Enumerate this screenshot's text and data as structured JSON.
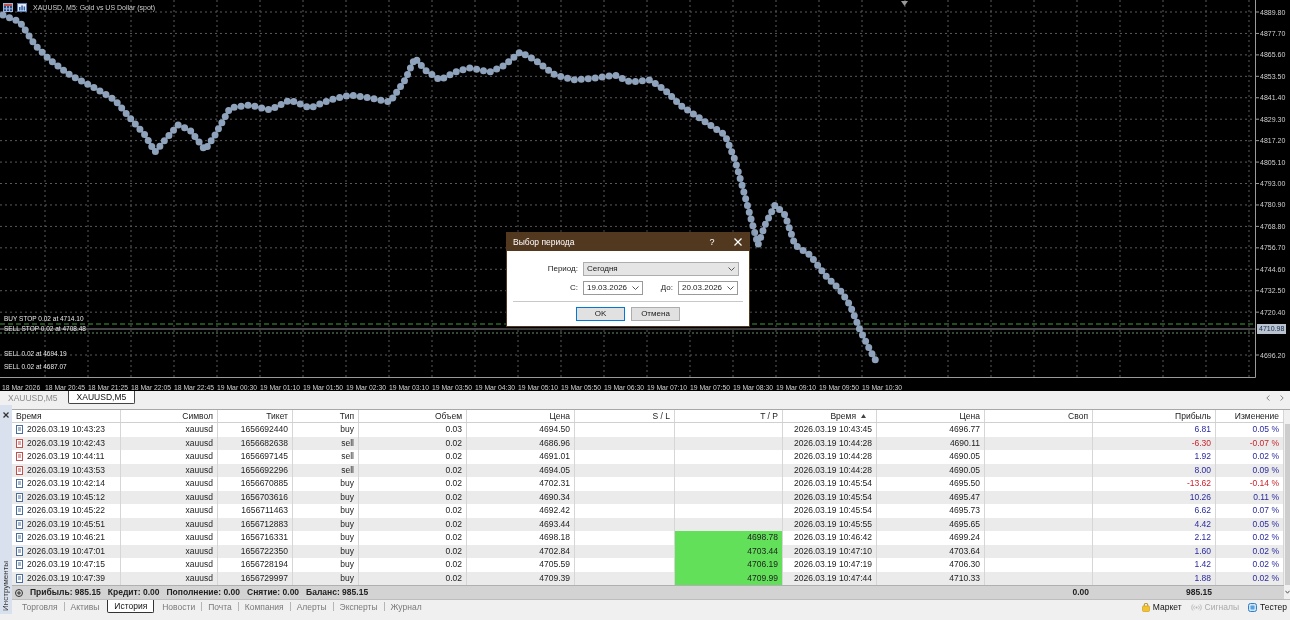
{
  "chart": {
    "title": "XAUUSD, M5: Gold vs US Dollar (spot)",
    "price_labels": [
      "4889.80",
      "4877.70",
      "4865.60",
      "4853.50",
      "4841.40",
      "4829.30",
      "4817.20",
      "4805.10",
      "4793.00",
      "4780.90",
      "4768.80",
      "4756.70",
      "4744.60",
      "4732.50",
      "4720.40",
      "4696.20"
    ],
    "current_price": "4710.98",
    "time_labels": [
      "18 Mar 2026",
      "18 Mar 20:45",
      "18 Mar 21:25",
      "18 Mar 22:05",
      "18 Mar 22:45",
      "19 Mar 00:30",
      "19 Mar 01:10",
      "19 Mar 01:50",
      "19 Mar 02:30",
      "19 Mar 03:10",
      "19 Mar 03:50",
      "19 Mar 04:30",
      "19 Mar 05:10",
      "19 Mar 05:50",
      "19 Mar 06:30",
      "19 Mar 07:10",
      "19 Mar 07:50",
      "19 Mar 08:30",
      "19 Mar 09:10",
      "19 Mar 09:50",
      "19 Mar 10:30"
    ],
    "order_lines": [
      {
        "label": "BUY STOP 0.02 at 4714.10",
        "kind": "buy_stop"
      },
      {
        "label": "SELL STOP 0.02 at 4708.48",
        "kind": "sell_stop"
      },
      {
        "label": "SELL 0.02 at 4694.19",
        "kind": "sell"
      },
      {
        "label": "SELL 0.02 at 4687.07",
        "kind": "sell"
      }
    ]
  },
  "dialog": {
    "title": "Выбор периода",
    "help": "?",
    "fields": [
      {
        "label": "Период:",
        "value": "Сегодня",
        "kind": "select"
      },
      {
        "label": "С:",
        "value": "19.03.2026",
        "kind": "date"
      },
      {
        "label": "До:",
        "value": "20.03.2026",
        "kind": "date"
      }
    ],
    "buttons": [
      {
        "label": "OK",
        "default": true
      },
      {
        "label": "Отмена",
        "default": false
      }
    ]
  },
  "chart_tabs": [
    {
      "label": "XAUUSD,M5",
      "selected": false
    },
    {
      "label": "XAUUSD,M5",
      "selected": true
    }
  ],
  "toolbox": {
    "title": "Инструменты",
    "table": {
      "columns": [
        {
          "label": "Время",
          "sorted": false
        },
        {
          "label": "Символ",
          "sorted": false
        },
        {
          "label": "Тикет",
          "sorted": false
        },
        {
          "label": "Тип",
          "sorted": false
        },
        {
          "label": "Объем",
          "sorted": false
        },
        {
          "label": "Цена",
          "sorted": false
        },
        {
          "label": "S / L",
          "sorted": false
        },
        {
          "label": "T / P",
          "sorted": false
        },
        {
          "label": "Время",
          "sorted": true
        },
        {
          "label": "Цена",
          "sorted": false
        },
        {
          "label": "Своп",
          "sorted": false
        },
        {
          "label": "Прибыль",
          "sorted": false
        },
        {
          "label": "Изменение",
          "sorted": false
        }
      ],
      "rows": [
        {
          "kind": "buy",
          "open_time": "2026.03.19 10:43:23",
          "symbol": "xauusd",
          "ticket": "1656692440",
          "type": "buy",
          "volume": "0.03",
          "open_price": "4694.50",
          "close_time": "2026.03.19 10:43:45",
          "close_price": "4696.77",
          "profit": "6.81",
          "change": "0.05 %",
          "loss": false
        },
        {
          "kind": "sell",
          "open_time": "2026.03.19 10:42:43",
          "symbol": "xauusd",
          "ticket": "1656682638",
          "type": "sell",
          "volume": "0.02",
          "open_price": "4686.96",
          "close_time": "2026.03.19 10:44:28",
          "close_price": "4690.11",
          "profit": "-6.30",
          "change": "-0.07 %",
          "loss": true
        },
        {
          "kind": "sell",
          "open_time": "2026.03.19 10:44:11",
          "symbol": "xauusd",
          "ticket": "1656697145",
          "type": "sell",
          "volume": "0.02",
          "open_price": "4691.01",
          "close_time": "2026.03.19 10:44:28",
          "close_price": "4690.05",
          "profit": "1.92",
          "change": "0.02 %",
          "loss": false
        },
        {
          "kind": "sell",
          "open_time": "2026.03.19 10:43:53",
          "symbol": "xauusd",
          "ticket": "1656692296",
          "type": "sell",
          "volume": "0.02",
          "open_price": "4694.05",
          "close_time": "2026.03.19 10:44:28",
          "close_price": "4690.05",
          "profit": "8.00",
          "change": "0.09 %",
          "loss": false
        },
        {
          "kind": "buy",
          "open_time": "2026.03.19 10:42:14",
          "symbol": "xauusd",
          "ticket": "1656670885",
          "type": "buy",
          "volume": "0.02",
          "open_price": "4702.31",
          "close_time": "2026.03.19 10:45:54",
          "close_price": "4695.50",
          "profit": "-13.62",
          "change": "-0.14 %",
          "loss": true
        },
        {
          "kind": "buy",
          "open_time": "2026.03.19 10:45:12",
          "symbol": "xauusd",
          "ticket": "1656703616",
          "type": "buy",
          "volume": "0.02",
          "open_price": "4690.34",
          "close_time": "2026.03.19 10:45:54",
          "close_price": "4695.47",
          "profit": "10.26",
          "change": "0.11 %",
          "loss": false
        },
        {
          "kind": "buy",
          "open_time": "2026.03.19 10:45:22",
          "symbol": "xauusd",
          "ticket": "1656711463",
          "type": "buy",
          "volume": "0.02",
          "open_price": "4692.42",
          "close_time": "2026.03.19 10:45:54",
          "close_price": "4695.73",
          "profit": "6.62",
          "change": "0.07 %",
          "loss": false
        },
        {
          "kind": "buy",
          "open_time": "2026.03.19 10:45:51",
          "symbol": "xauusd",
          "ticket": "1656712883",
          "type": "buy",
          "volume": "0.02",
          "open_price": "4693.44",
          "close_time": "2026.03.19 10:45:55",
          "close_price": "4695.65",
          "profit": "4.42",
          "change": "0.05 %",
          "loss": false
        },
        {
          "kind": "buy",
          "open_time": "2026.03.19 10:46:21",
          "symbol": "xauusd",
          "ticket": "1656716331",
          "type": "buy",
          "volume": "0.02",
          "open_price": "4698.18",
          "tp": "4698.78",
          "close_time": "2026.03.19 10:46:42",
          "close_price": "4699.24",
          "profit": "2.12",
          "change": "0.02 %",
          "loss": false
        },
        {
          "kind": "buy",
          "open_time": "2026.03.19 10:47:01",
          "symbol": "xauusd",
          "ticket": "1656722350",
          "type": "buy",
          "volume": "0.02",
          "open_price": "4702.84",
          "tp": "4703.44",
          "close_time": "2026.03.19 10:47:10",
          "close_price": "4703.64",
          "profit": "1.60",
          "change": "0.02 %",
          "loss": false
        },
        {
          "kind": "buy",
          "open_time": "2026.03.19 10:47:15",
          "symbol": "xauusd",
          "ticket": "1656728194",
          "type": "buy",
          "volume": "0.02",
          "open_price": "4705.59",
          "tp": "4706.19",
          "close_time": "2026.03.19 10:47:19",
          "close_price": "4706.30",
          "profit": "1.42",
          "change": "0.02 %",
          "loss": false
        },
        {
          "kind": "buy",
          "open_time": "2026.03.19 10:47:39",
          "symbol": "xauusd",
          "ticket": "1656729997",
          "type": "buy",
          "volume": "0.02",
          "open_price": "4709.39",
          "tp": "4709.99",
          "close_time": "2026.03.19 10:47:44",
          "close_price": "4710.33",
          "profit": "1.88",
          "change": "0.02 %",
          "loss": false
        }
      ],
      "summary": {
        "items": [
          "Прибыль: 985.15",
          "Кредит: 0.00",
          "Пополнение: 0.00",
          "Снятие: 0.00",
          "Баланс: 985.15"
        ],
        "swap_total": "0.00",
        "profit_total": "985.15"
      }
    },
    "tabs": [
      {
        "label": "Торговля",
        "selected": false
      },
      {
        "label": "Активы",
        "selected": false
      },
      {
        "label": "История",
        "selected": true
      },
      {
        "label": "Новости",
        "selected": false
      },
      {
        "label": "Почта",
        "selected": false
      },
      {
        "label": "Компания",
        "selected": false
      },
      {
        "label": "Алерты",
        "selected": false
      },
      {
        "label": "Эксперты",
        "selected": false
      },
      {
        "label": "Журнал",
        "selected": false
      }
    ],
    "links": [
      {
        "label": "Маркет",
        "kind": "market",
        "disabled": false
      },
      {
        "label": "Сигналы",
        "kind": "signals",
        "disabled": true
      },
      {
        "label": "Тестер",
        "kind": "tester",
        "disabled": false
      }
    ]
  }
}
